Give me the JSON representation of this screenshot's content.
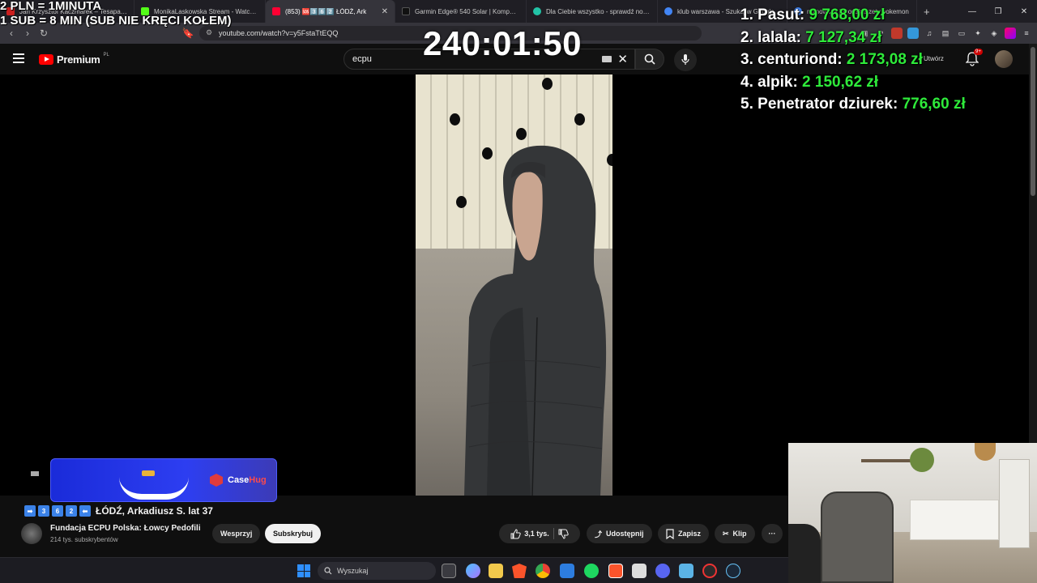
{
  "browser": {
    "tabs": [
      {
        "title": "Jan Krzysztof Kaczmarek – Tesapany",
        "color": "#cc1f1f",
        "active": false
      },
      {
        "title": "MonikaLaskowska Stream - Watch Live",
        "color": "#53fc18",
        "active": false
      },
      {
        "title": "(853) 🆘3️⃣6️⃣2️⃣ ŁÓDŹ, Ark",
        "color": "#ff0033",
        "active": true
      },
      {
        "title": "Garmin Edge® 540 Solar | Komputery",
        "color": "#111111",
        "active": false
      },
      {
        "title": "Dla Ciebie wszystko - sprawdź nowe",
        "color": "#22c3a6",
        "active": false
      },
      {
        "title": "klub warszawa - Szukaj w Google",
        "color": "#4285f4",
        "active": false
      },
      {
        "title": "najnowsze japońskie zety pokemon",
        "color": "#4285f4",
        "active": false
      }
    ],
    "new_tab": "+",
    "url": "youtube.com/watch?v=y5FstaTtEQQ"
  },
  "youtube": {
    "logo_text": "Premium",
    "country": "PL",
    "search_value": "ecpu",
    "notif_count": "9+",
    "partial_label": "Utwórz"
  },
  "video": {
    "title_emojis": [
      "➡",
      "3",
      "6",
      "2",
      "⬅"
    ],
    "title": "ŁÓDŹ, Arkadiusz S. lat 37",
    "channel": "Fundacja ECPU Polska: Łowcy Pedofili",
    "subscribers": "214 tys. subskrybentów",
    "support_label": "Wesprzyj",
    "subscribe_label": "Subskrybuj",
    "likes": "3,1 tys.",
    "share_label": "Udostępnij",
    "save_label": "Zapisz",
    "clip_label": "Klip",
    "more_label": "···"
  },
  "ad": {
    "brand_a": "Case",
    "brand_b": "Hug"
  },
  "overlay": {
    "rule1": "2 PLN = 1MINUTA",
    "rule2": "1 SUB = 8 MIN (SUB NIE KRĘCI KOŁEM)",
    "timer": "240:01:50",
    "leaderboard": [
      {
        "rank": "1.",
        "name": "Pasut:",
        "amount": "9 768,00 zł"
      },
      {
        "rank": "2.",
        "name": "lalala:",
        "amount": "7 127,34 zł"
      },
      {
        "rank": "3.",
        "name": "centuriond:",
        "amount": "2 173,08 zł"
      },
      {
        "rank": "4.",
        "name": "alpik:",
        "amount": "2 150,62 zł"
      },
      {
        "rank": "5.",
        "name": "Penetrator dziurek:",
        "amount": "776,60 zł"
      }
    ]
  },
  "taskbar": {
    "search_placeholder": "Wyszukaj"
  }
}
